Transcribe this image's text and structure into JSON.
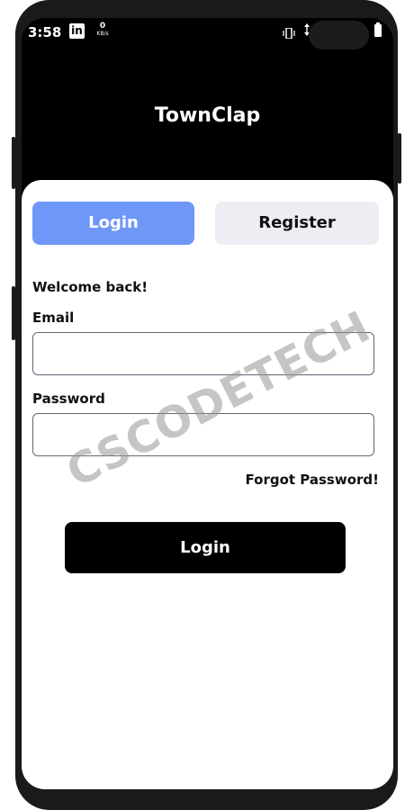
{
  "status_bar": {
    "time": "3:58",
    "linkedin_glyph": "in",
    "net_speed_value": "0",
    "net_speed_unit": "KB/s",
    "icons": [
      "linkedin-icon",
      "vibrate-icon",
      "data-arrows-icon",
      "battery-icon"
    ]
  },
  "app": {
    "title": "TownClap"
  },
  "tabs": {
    "login_label": "Login",
    "register_label": "Register",
    "active": "Login"
  },
  "form": {
    "welcome": "Welcome back!",
    "email_label": "Email",
    "email_value": "",
    "password_label": "Password",
    "password_value": "",
    "forgot_label": "Forgot Password!",
    "submit_label": "Login"
  },
  "watermark": "CSCODETECH",
  "colors": {
    "active_tab": "#6f97f8",
    "inactive_tab": "#eceef3",
    "primary_button": "#000000",
    "header_bg": "#000000"
  }
}
